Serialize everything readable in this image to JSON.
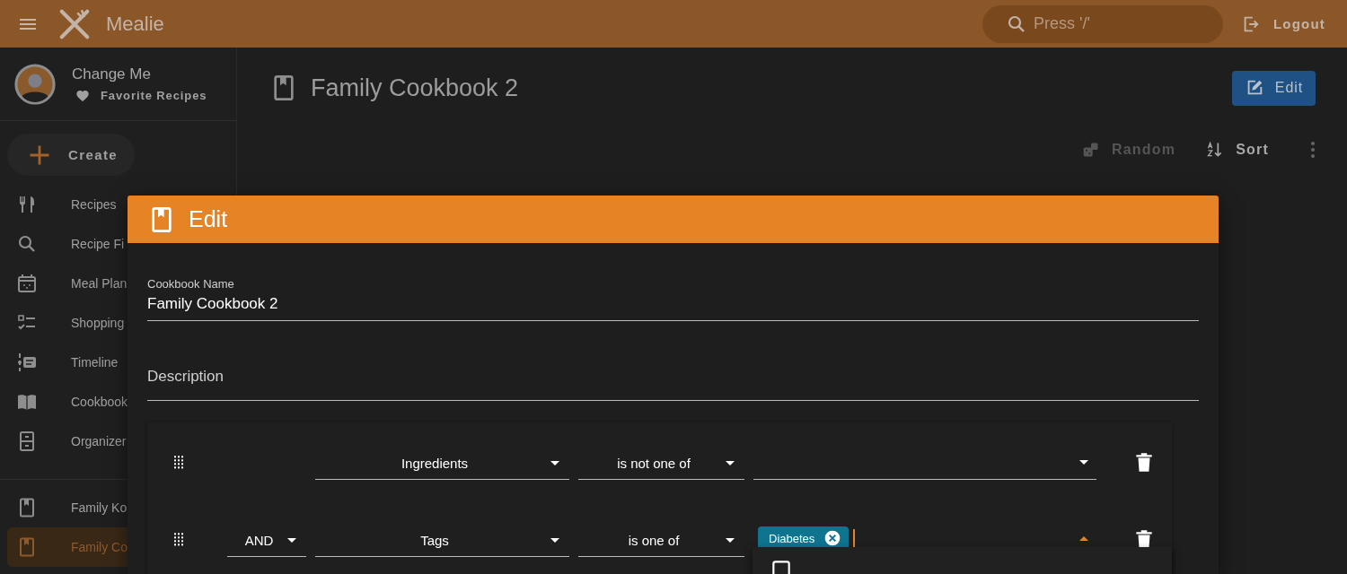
{
  "app_bar": {
    "title": "Mealie",
    "search": {
      "placeholder": "Press '/'"
    },
    "logout": "Logout"
  },
  "sidebar": {
    "user": {
      "name": "Change Me",
      "favorites": "Favorite Recipes"
    },
    "create": "Create",
    "items": [
      {
        "label": "Recipes",
        "selected": false
      },
      {
        "label": "Recipe Fi",
        "selected": false
      },
      {
        "label": "Meal Plan",
        "selected": false
      },
      {
        "label": "Shopping",
        "selected": false
      },
      {
        "label": "Timeline",
        "selected": false
      },
      {
        "label": "Cookbook",
        "selected": false
      },
      {
        "label": "Organizer",
        "selected": false
      }
    ],
    "cookbooks": [
      {
        "label": "Family Ko",
        "selected": false
      },
      {
        "label": "Family Co",
        "selected": true
      }
    ]
  },
  "page": {
    "title": "Family Cookbook 2",
    "edit_button": "Edit",
    "actions": [
      {
        "label": "Random",
        "disabled": true
      },
      {
        "label": "Sort",
        "disabled": false
      }
    ]
  },
  "dialog": {
    "title": "Edit",
    "name_field": {
      "label": "Cookbook Name",
      "value": "Family Cookbook 2"
    },
    "description_field": {
      "placeholder": "Description"
    },
    "rules": [
      {
        "field": "Ingredients",
        "operator": "is not one of",
        "focused": false
      },
      {
        "conjunction": "AND",
        "field": "Tags",
        "operator": "is one of",
        "chips": [
          "Diabetes"
        ],
        "focused": true
      }
    ],
    "menu": {
      "items": [
        {
          "checked": false
        }
      ]
    }
  }
}
